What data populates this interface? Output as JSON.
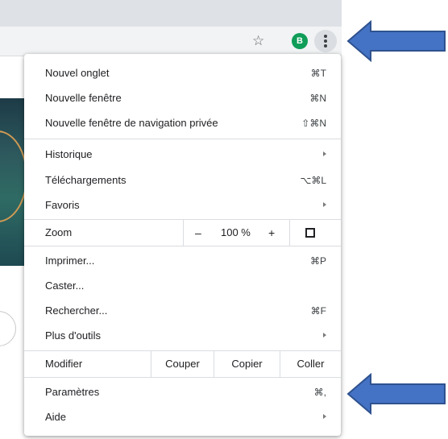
{
  "toolbar": {
    "star_icon": "star-icon",
    "avatar_letter": "B",
    "avatar_color": "#0f9d58",
    "menu_icon": "kebab-menu-icon"
  },
  "menu": {
    "new_tab": {
      "label": "Nouvel onglet",
      "shortcut": "⌘T"
    },
    "new_window": {
      "label": "Nouvelle fenêtre",
      "shortcut": "⌘N"
    },
    "incognito": {
      "label": "Nouvelle fenêtre de navigation privée",
      "shortcut": "⇧⌘N"
    },
    "history": {
      "label": "Historique"
    },
    "downloads": {
      "label": "Téléchargements",
      "shortcut": "⌥⌘L"
    },
    "bookmarks": {
      "label": "Favoris"
    },
    "zoom": {
      "label": "Zoom",
      "minus": "–",
      "value": "100 %",
      "plus": "+"
    },
    "print": {
      "label": "Imprimer...",
      "shortcut": "⌘P"
    },
    "cast": {
      "label": "Caster..."
    },
    "find": {
      "label": "Rechercher...",
      "shortcut": "⌘F"
    },
    "more_tools": {
      "label": "Plus d'outils"
    },
    "edit": {
      "label": "Modifier",
      "cut": "Couper",
      "copy": "Copier",
      "paste": "Coller"
    },
    "settings": {
      "label": "Paramètres",
      "shortcut": "⌘,"
    },
    "help": {
      "label": "Aide"
    }
  },
  "annotations": {
    "arrow_color": "#4472c4",
    "arrow_border": "#2f528f"
  }
}
